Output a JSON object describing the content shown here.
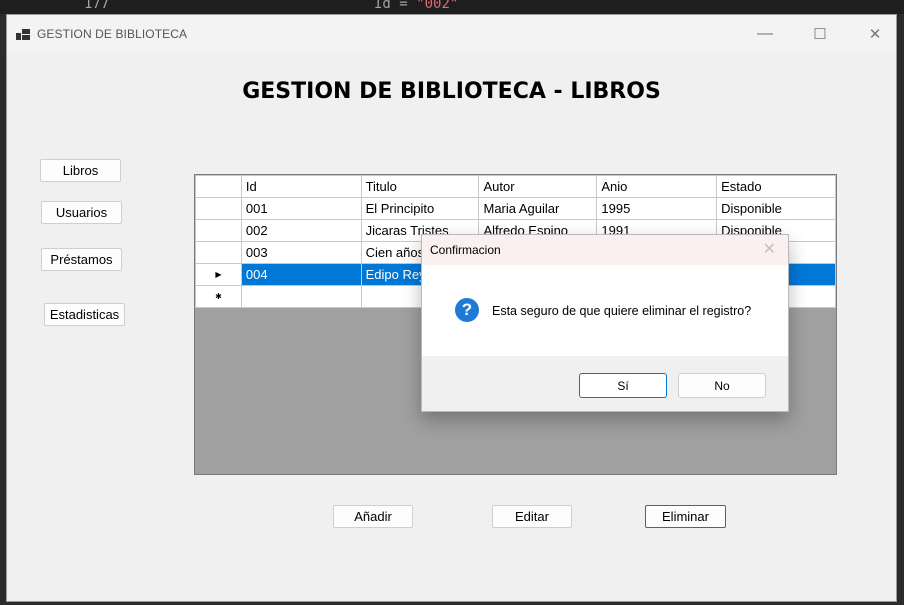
{
  "background_code": {
    "fragment_num": "177",
    "fragment_code": "Id = ",
    "fragment_str": "\"002\""
  },
  "window": {
    "title": "GESTION DE BIBLIOTECA",
    "controls": {
      "minimize": "—",
      "maximize": "☐",
      "close": "✕"
    }
  },
  "heading": "GESTION DE BIBLIOTECA - LIBROS",
  "sidebar": {
    "items": [
      {
        "label": "Libros"
      },
      {
        "label": "Usuarios"
      },
      {
        "label": "Préstamos"
      },
      {
        "label": "Estadisticas"
      }
    ]
  },
  "grid": {
    "columns": [
      "Id",
      "Titulo",
      "Autor",
      "Anio",
      "Estado"
    ],
    "rows": [
      {
        "marker": "",
        "cells": [
          "001",
          "El Principito",
          "Maria Aguilar",
          "1995",
          "Disponible"
        ]
      },
      {
        "marker": "",
        "cells": [
          "002",
          "Jicaras Tristes",
          "Alfredo Espino",
          "1991",
          "Disponible"
        ]
      },
      {
        "marker": "",
        "cells": [
          "003",
          "Cien años",
          "",
          "",
          ""
        ]
      },
      {
        "marker": "▶",
        "cells": [
          "004",
          "Edipo Rey",
          "",
          "",
          ""
        ],
        "selected": true
      },
      {
        "marker": "✱",
        "cells": [
          "",
          "",
          "",
          "",
          ""
        ]
      }
    ]
  },
  "actions": {
    "add": "Añadir",
    "edit": "Editar",
    "delete": "Eliminar"
  },
  "dialog": {
    "title": "Confirmacion",
    "close": "✕",
    "icon": "question-icon",
    "icon_glyph": "?",
    "message": "Esta seguro de que quiere eliminar el registro?",
    "yes": "Sí",
    "no": "No"
  },
  "colors": {
    "selection": "#0078d7",
    "dialog_title_bg": "#faf0f0",
    "grid_empty_bg": "#a0a0a0"
  }
}
